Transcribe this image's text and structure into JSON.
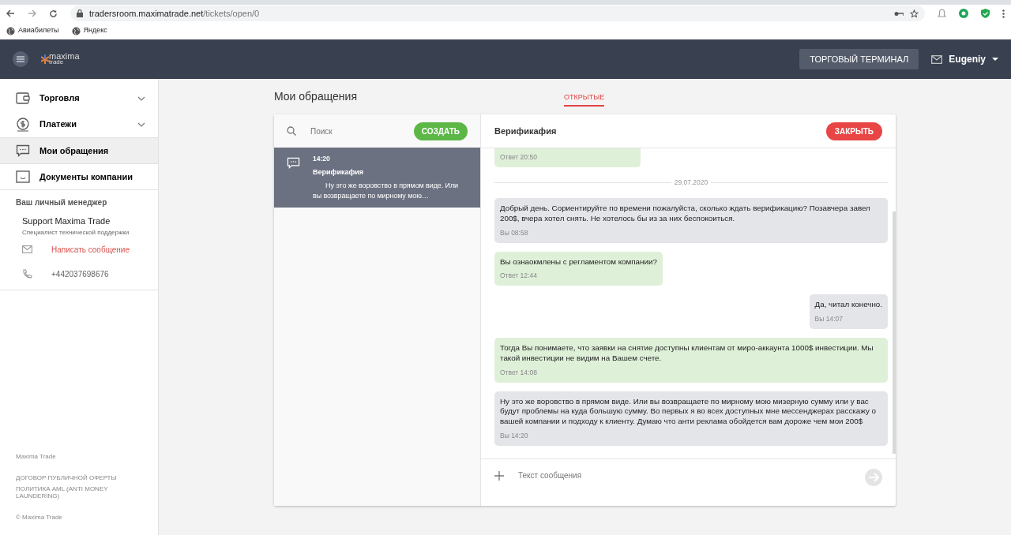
{
  "browser": {
    "url_host": "tradersroom.maximatrade.net",
    "url_path": "/tickets/open/0",
    "bookmarks": [
      "Авиабилеты",
      "Яндекс"
    ]
  },
  "header": {
    "logo_top": "maxima",
    "logo_bottom": "trade",
    "terminal_button": "ТОРГОВЫЙ ТЕРМИНАЛ",
    "user": "Eugeniy"
  },
  "sidebar": {
    "items": [
      {
        "label": "Торговля",
        "expandable": true,
        "selected": false
      },
      {
        "label": "Платежи",
        "expandable": true,
        "selected": false
      },
      {
        "label": "Мои обращения",
        "expandable": false,
        "selected": true
      },
      {
        "label": "Документы компании",
        "expandable": false,
        "selected": false
      }
    ],
    "manager_heading": "Ваш личный менеджер",
    "manager_name": "Support Maxima Trade",
    "manager_role": "Специалист технической поддержки",
    "write_link": "Написать сообщение",
    "phone": "+442037698676",
    "footer_brand": "Maxima Trade",
    "footer_links": [
      "ДОГОВОР ПУБЛИЧНОЙ ОФЕРТЫ",
      "ПОЛИТИКА AML (ANTI MONEY LAUNDERING)"
    ],
    "copyright": "© Maxima Trade"
  },
  "page": {
    "title": "Мои обращения",
    "tabs": [
      {
        "label": "ОТКРЫТЫЕ",
        "selected": true
      }
    ]
  },
  "tickets": {
    "search_placeholder": "Поиск",
    "create_button": "СОЗДАТЬ",
    "items": [
      {
        "time": "14:20",
        "subject": "Верификафия",
        "preview": "Ну это же воровство в прямом виде. Или вы возвращаете по мирному мою…",
        "selected": true
      }
    ]
  },
  "chat": {
    "title": "Верификафия",
    "close_button": "ЗАКРЫТЬ",
    "messages": [
      {
        "kind": "reply",
        "meta": "Ответ 20:50"
      },
      {
        "kind": "date",
        "text": "29.07.2020"
      },
      {
        "kind": "mine",
        "text": "Добрый день. Сориентируйте по времени пожалуйста, сколько ждать верификацию? Позавчера завел 200$, вчера хотел снять. Не хотелось бы из за них беспокоиться.",
        "meta": "Вы 08:58"
      },
      {
        "kind": "reply",
        "text": "Вы ознаокмлены с регламентом компании?",
        "meta": "Ответ 12:44"
      },
      {
        "kind": "mine",
        "text": "Да, читал конечно.",
        "meta": "Вы 14:07"
      },
      {
        "kind": "reply",
        "text": "Тогда Вы понимаете, что заявки на снятие доступны клиентам от миро-аккаунта 1000$ инвестиции. Мы такой инвестиции не видим на Вашем счете.",
        "meta": "Ответ 14:08"
      },
      {
        "kind": "mine",
        "text": "Ну это же воровство в прямом виде. Или вы возвращаете по мирному мою мизерную сумму или у вас будут проблемы на куда большую сумму. Во первых я во всех доступных мне мессенджерах расскажу о вашей компании и подходу к клиенту. Думаю что анти реклама обойдется вам дороже чем мои 200$",
        "meta": "Вы 14:20"
      }
    ],
    "input_placeholder": "Текст сообщения"
  }
}
